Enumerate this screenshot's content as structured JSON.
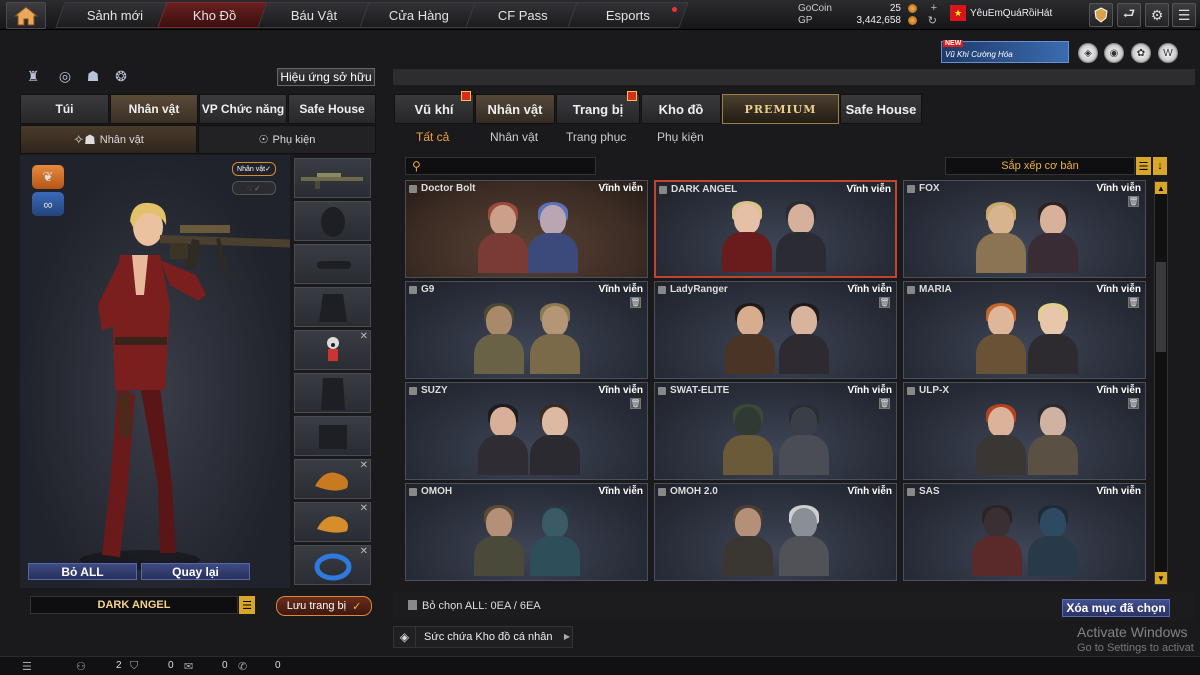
{
  "topbar": {
    "tabs": [
      {
        "label": "Sảnh mới"
      },
      {
        "label": "Kho Đồ"
      },
      {
        "label": "Báu Vật"
      },
      {
        "label": "Cửa Hàng"
      },
      {
        "label": "CF Pass"
      },
      {
        "label": "Esports"
      }
    ],
    "currency": {
      "gocoin_label": "GoCoin",
      "gocoin_value": "25",
      "gp_label": "GP",
      "gp_value": "3,442,658"
    },
    "username": "YêuEmQuáRồiHát"
  },
  "promo": {
    "badge": "NEW",
    "text": "Vũ Khí Cường Hóa"
  },
  "left": {
    "effects_label": "Hiệu ứng sở hữu",
    "tabs": [
      {
        "label": "Túi"
      },
      {
        "label": "Nhân vật"
      },
      {
        "label": "VP Chức năng"
      },
      {
        "label": "Safe House"
      }
    ],
    "subtabs": [
      {
        "label": "Nhân vật"
      },
      {
        "label": "Phụ kiện"
      }
    ],
    "char_tag": "Nhân vật",
    "bo_all": "Bỏ ALL",
    "quay_lai": "Quay lại",
    "char_name": "DARK ANGEL",
    "save_label": "Lưu trang bị"
  },
  "right": {
    "tabs": [
      {
        "label": "Vũ khí"
      },
      {
        "label": "Nhân vật"
      },
      {
        "label": "Trang bị"
      },
      {
        "label": "Kho đồ"
      },
      {
        "label": "PREMIUM"
      },
      {
        "label": "Safe House"
      }
    ],
    "subtabs": [
      {
        "label": "Tất cả"
      },
      {
        "label": "Nhân vật"
      },
      {
        "label": "Trang phục"
      },
      {
        "label": "Phụ kiện"
      }
    ],
    "sort_label": "Sắp xếp cơ bản",
    "items": [
      {
        "name": "Doctor Bolt",
        "duration": "Vĩnh viễn"
      },
      {
        "name": "DARK ANGEL",
        "duration": "Vĩnh viễn"
      },
      {
        "name": "FOX",
        "duration": "Vĩnh viễn"
      },
      {
        "name": "G9",
        "duration": "Vĩnh viễn"
      },
      {
        "name": "LadyRanger",
        "duration": "Vĩnh viễn"
      },
      {
        "name": "MARIA",
        "duration": "Vĩnh viễn"
      },
      {
        "name": "SUZY",
        "duration": "Vĩnh viễn"
      },
      {
        "name": "SWAT-ELITE",
        "duration": "Vĩnh viễn"
      },
      {
        "name": "ULP-X",
        "duration": "Vĩnh viễn"
      },
      {
        "name": "OMOH",
        "duration": "Vĩnh viễn"
      },
      {
        "name": "OMOH 2.0",
        "duration": "Vĩnh viễn"
      },
      {
        "name": "SAS",
        "duration": "Vĩnh viễn"
      }
    ],
    "clear_all": "Bỏ chọn ALL: 0EA / 6EA",
    "remove_selected": "Xóa mục đã chọn",
    "capacity": "Sức chứa Kho đồ cá nhân"
  },
  "watermark": {
    "title": "Activate Windows",
    "subtitle": "Go to Settings to activat"
  },
  "statusbar": {
    "v1": "2",
    "v2": "0",
    "v3": "0",
    "v4": "0"
  }
}
